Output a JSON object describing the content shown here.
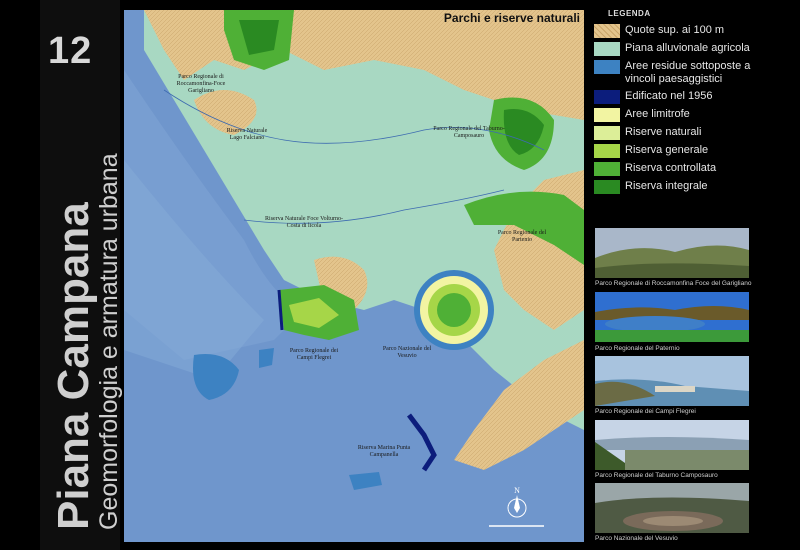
{
  "page": {
    "number": "12",
    "title": "Piana Campana",
    "subtitle": "Geomorfologia e armatura urbana"
  },
  "map": {
    "title": "Parchi e riserve naturali",
    "labels": [
      {
        "id": "roccamonfina",
        "text": "Parco Regionale di Roccamonfina-Foce Garigliano"
      },
      {
        "id": "falciano",
        "text": "Riserva Naturale Lago Falciano"
      },
      {
        "id": "taburno",
        "text": "Parco Regionale del Taburno-Camposauro"
      },
      {
        "id": "partenio",
        "text": "Parco Regionale del Partenio"
      },
      {
        "id": "volturno",
        "text": "Riserva Naturale Foce Volturno-Costa di licola"
      },
      {
        "id": "campi-flegrei",
        "text": "Parco Regionale dei Campi Flegrei"
      },
      {
        "id": "vesuvio",
        "text": "Parco Nazionale del Vesuvio"
      },
      {
        "id": "punta-campanella",
        "text": "Riserva Marina Punta Campanella"
      }
    ],
    "compass": "N"
  },
  "legend": {
    "title": "LEGENDA",
    "items": [
      {
        "label": "Quote sup. ai 100 m",
        "color": "#e3c48c"
      },
      {
        "label": "Piana alluvionale agricola",
        "color": "#a8d8c2"
      },
      {
        "label": "Aree residue sottoposte a vincoli paesaggistici",
        "color": "#3d82c2"
      },
      {
        "label": "Edificato nel 1956",
        "color": "#0c1d7c"
      },
      {
        "label": "Aree limitrofe",
        "color": "#f2f4a2"
      },
      {
        "label": "Riserve naturali",
        "color": "#dcee98"
      },
      {
        "label": "Riserva generale",
        "color": "#a6d648"
      },
      {
        "label": "Riserva controllata",
        "color": "#4fb036"
      },
      {
        "label": "Riserva integrale",
        "color": "#2a8a22"
      }
    ]
  },
  "photos": [
    {
      "caption": "Parco Regionale di Roccamonfina Foce del Garigliano"
    },
    {
      "caption": "Parco Regionale del Paternio"
    },
    {
      "caption": "Parco Regionale dei Campi Flegrei"
    },
    {
      "caption": "Parco Regionale del Taburno Camposauro"
    },
    {
      "caption": "Parco Nazionale del Vesuvio"
    }
  ]
}
